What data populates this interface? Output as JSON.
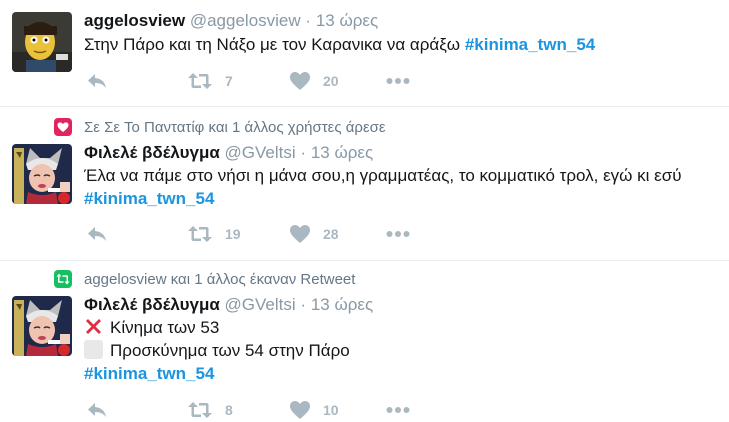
{
  "tweets": [
    {
      "context": null,
      "name": "aggelosview",
      "handle": "@aggelosview",
      "separator": "·",
      "time": "13 ώρες",
      "text": "Στην Πάρο και τη Νάξο με τον Καρανικα να αράξω",
      "hashtag": "#kinima_twn_54",
      "retweets": "7",
      "likes": "20"
    },
    {
      "context": "Σε Σε Το Παντατίφ και 1 άλλος χρήστες άρεσε",
      "name": "Φιλελέ βδέλυγμα",
      "handle": "@GVeltsi",
      "separator": "·",
      "time": "13 ώρες",
      "text": "Έλα να πάμε στο νήσι η μάνα σου,η γραμματέας, το κομματικό τρολ, εγώ κι εσύ",
      "hashtag": "#kinima_twn_54",
      "retweets": "19",
      "likes": "28"
    },
    {
      "context": "aggelosview και 1 άλλος έκαναν Retweet",
      "name": "Φιλελέ βδέλυγμα",
      "handle": "@GVeltsi",
      "separator": "·",
      "time": "13 ώρες",
      "line1": "Κίνημα των 53",
      "line2": "Προσκύνημα των 54 στην Πάρο",
      "hashtag": "#kinima_twn_54",
      "retweets": "8",
      "likes": "10"
    }
  ],
  "colors": {
    "hashtag": "#1b95e0",
    "like_context": "#e0245e",
    "retweet_context": "#17bf63",
    "action_icon": "#aab8c2"
  }
}
